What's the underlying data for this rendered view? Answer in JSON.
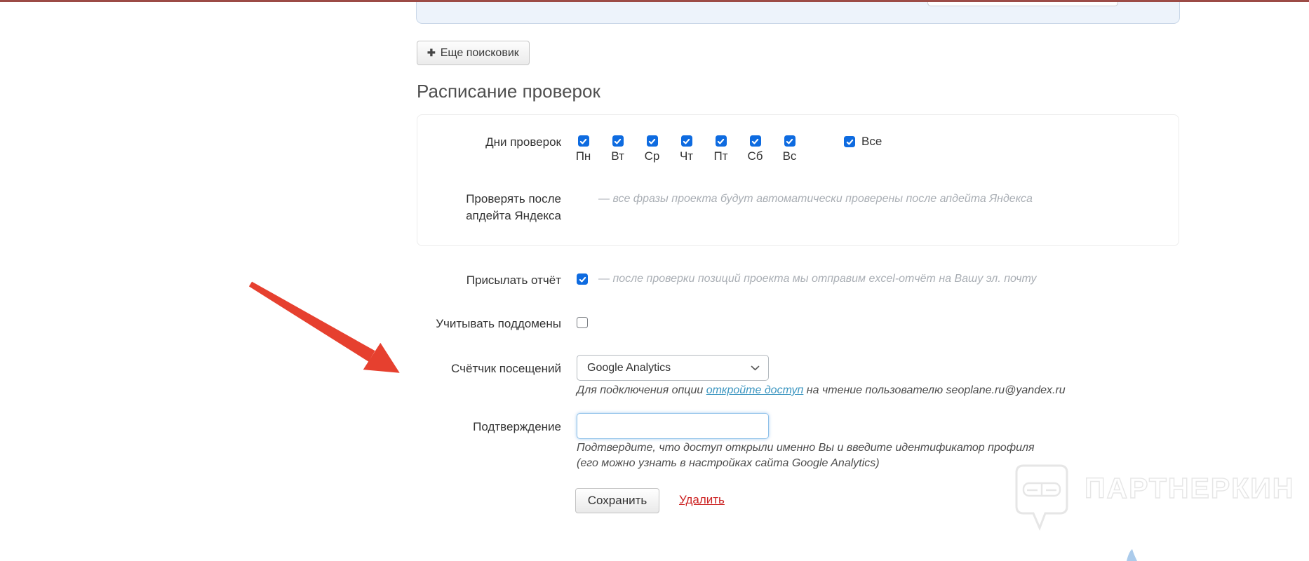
{
  "toolbar": {
    "add_engine_button": "Еще поисковик",
    "plus_icon": "✚"
  },
  "section": {
    "title": "Расписание проверок"
  },
  "schedule_box": {
    "days_label": "Дни проверок",
    "days": [
      {
        "label": "Пн",
        "checked": true
      },
      {
        "label": "Вт",
        "checked": true
      },
      {
        "label": "Ср",
        "checked": true
      },
      {
        "label": "Чт",
        "checked": true
      },
      {
        "label": "Пт",
        "checked": true
      },
      {
        "label": "Сб",
        "checked": true
      },
      {
        "label": "Вс",
        "checked": true
      }
    ],
    "all_checkbox_label": "Все",
    "all_checked": true,
    "after_update_label": "Проверять после апдейта Яндекса",
    "after_update_checked": true,
    "after_update_hint": "— все фразы проекта будут автоматически проверены после апдейта Яндекса"
  },
  "options": {
    "send_report_label": "Присылать отчёт",
    "send_report_checked": true,
    "send_report_hint": "— после проверки позиций проекта мы отправим excel-отчёт на Вашу эл. почту",
    "subdomains_label": "Учитывать поддомены",
    "subdomains_checked": false,
    "counter_label": "Счётчик посещений",
    "counter_selected": "Google Analytics",
    "counter_hint_before": "Для подключения опции ",
    "counter_hint_link": "откройте доступ",
    "counter_hint_after": " на чтение пользователю seoplane.ru@yandex.ru",
    "confirm_label": "Подтверждение",
    "confirm_value": "",
    "confirm_hint_1": "Подтвердите, что доступ открыли именно Вы и введите идентификатор профиля",
    "confirm_hint_2": "(его можно узнать в настройках сайта Google Analytics)"
  },
  "actions": {
    "save": "Сохранить",
    "delete": "Удалить"
  },
  "watermark": {
    "brand": "ПАРТНЕРКИН"
  },
  "colors": {
    "top_line": "#9c4b46",
    "checkbox_blue": "#0e6be0",
    "link_teal": "#3a95c0",
    "delete_red": "#cc2222",
    "arrow_red": "#e6402f"
  }
}
